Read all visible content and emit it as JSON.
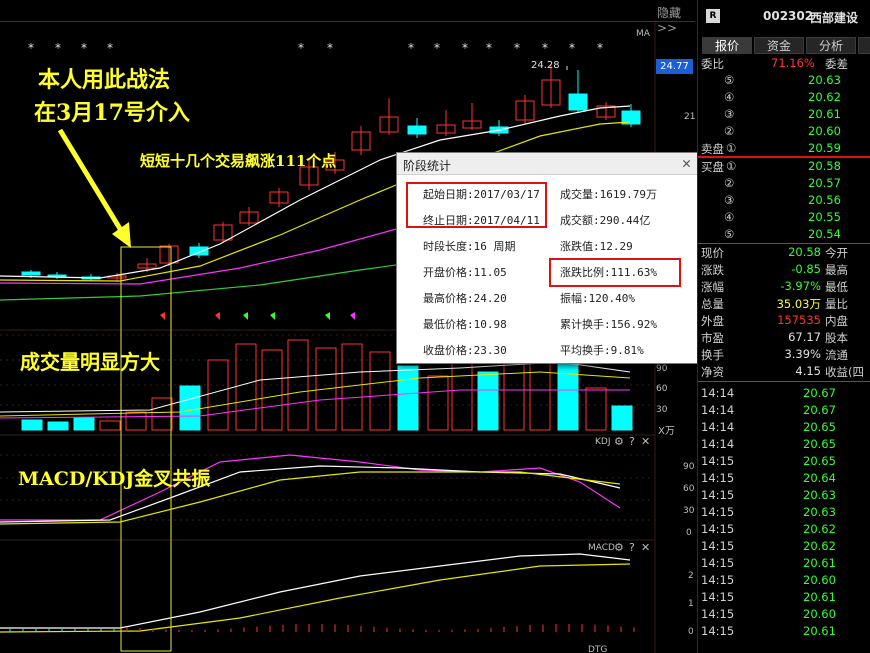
{
  "window": {
    "hide_label": "隐藏>>"
  },
  "indicator_labels": {
    "ma": "MA",
    "kdj": "KDJ",
    "macd": "MACD",
    "volume_unit": "X万",
    "next": "DTG"
  },
  "annotations": {
    "strategy_line1": "本人用此战法",
    "strategy_line2": "在3月17号介入",
    "rise_note": "短短十几个交易飙涨111个点",
    "volume_note": "成交量明显方大",
    "crossover_note": "MACD/KDJ金叉共振"
  },
  "price_chart": {
    "high_label": "24.28",
    "current_price_tag": "24.77",
    "right_tick": "21",
    "star_marker": "*"
  },
  "volume_ticks": [
    "90",
    "60",
    "30"
  ],
  "kdj_ticks": [
    "90",
    "60",
    "30",
    "0"
  ],
  "macd_ticks": [
    "2",
    "1",
    "0"
  ],
  "popup": {
    "title": "阶段统计",
    "rows": [
      [
        "起始日期:2017/03/17",
        "成交量:1619.79万"
      ],
      [
        "终止日期:2017/04/11",
        "成交额:290.44亿"
      ],
      [
        "时段长度:16 周期",
        "涨跌值:12.29"
      ],
      [
        "开盘价格:11.05",
        "涨跌比例:111.63%"
      ],
      [
        "最高价格:24.20",
        "振幅:120.40%"
      ],
      [
        "最低价格:10.98",
        "累计换手:156.92%"
      ],
      [
        "收盘价格:23.30",
        "平均换手:9.81%"
      ]
    ]
  },
  "quote": {
    "badge": "R",
    "code": "002302",
    "name": "西部建设",
    "tabs": [
      "报价",
      "资金",
      "分析"
    ],
    "weibi_label": "委比",
    "weibi_value": "71.16%",
    "weicha_label": "委差",
    "sell_label": "卖盘",
    "buy_label": "买盘",
    "sell_levels": [
      {
        "num": "⑤",
        "price": "20.63"
      },
      {
        "num": "④",
        "price": "20.62"
      },
      {
        "num": "③",
        "price": "20.61"
      },
      {
        "num": "②",
        "price": "20.60"
      },
      {
        "num": "①",
        "price": "20.59"
      }
    ],
    "buy_levels": [
      {
        "num": "①",
        "price": "20.58"
      },
      {
        "num": "②",
        "price": "20.57"
      },
      {
        "num": "③",
        "price": "20.56"
      },
      {
        "num": "④",
        "price": "20.55"
      },
      {
        "num": "⑤",
        "price": "20.54"
      }
    ],
    "stats": [
      {
        "label": "现价",
        "value": "20.58",
        "label2": "今开",
        "color": "#33ff33"
      },
      {
        "label": "涨跌",
        "value": "-0.85",
        "label2": "最高",
        "color": "#33ff33"
      },
      {
        "label": "涨幅",
        "value": "-3.97%",
        "label2": "最低",
        "color": "#33ff33"
      },
      {
        "label": "总量",
        "value": "35.03万",
        "label2": "量比",
        "color": "#ffff33"
      },
      {
        "label": "外盘",
        "value": "157535",
        "label2": "内盘",
        "color": "#ff3333"
      },
      {
        "label": "市盈",
        "value": "67.17",
        "label2": "股本",
        "color": "#e0e0e0"
      },
      {
        "label": "换手",
        "value": "3.39%",
        "label2": "流通",
        "color": "#e0e0e0"
      },
      {
        "label": "净资",
        "value": "4.15",
        "label2": "收益(四",
        "color": "#e0e0e0"
      }
    ],
    "ticks": [
      {
        "time": "14:14",
        "price": "20.67"
      },
      {
        "time": "14:14",
        "price": "20.67"
      },
      {
        "time": "14:14",
        "price": "20.65"
      },
      {
        "time": "14:14",
        "price": "20.65"
      },
      {
        "time": "14:15",
        "price": "20.65"
      },
      {
        "time": "14:15",
        "price": "20.64"
      },
      {
        "time": "14:15",
        "price": "20.63"
      },
      {
        "time": "14:15",
        "price": "20.63"
      },
      {
        "time": "14:15",
        "price": "20.62"
      },
      {
        "time": "14:15",
        "price": "20.62"
      },
      {
        "time": "14:15",
        "price": "20.61"
      },
      {
        "time": "14:15",
        "price": "20.60"
      },
      {
        "time": "14:15",
        "price": "20.61"
      },
      {
        "time": "14:15",
        "price": "20.60"
      },
      {
        "time": "14:15",
        "price": "20.61"
      }
    ]
  },
  "colors": {
    "up": "#ff3333",
    "down": "#00ffff",
    "highlight_box": "#e01010",
    "annotation": "#ffff2a",
    "price_tag": "#1a5fd6"
  }
}
